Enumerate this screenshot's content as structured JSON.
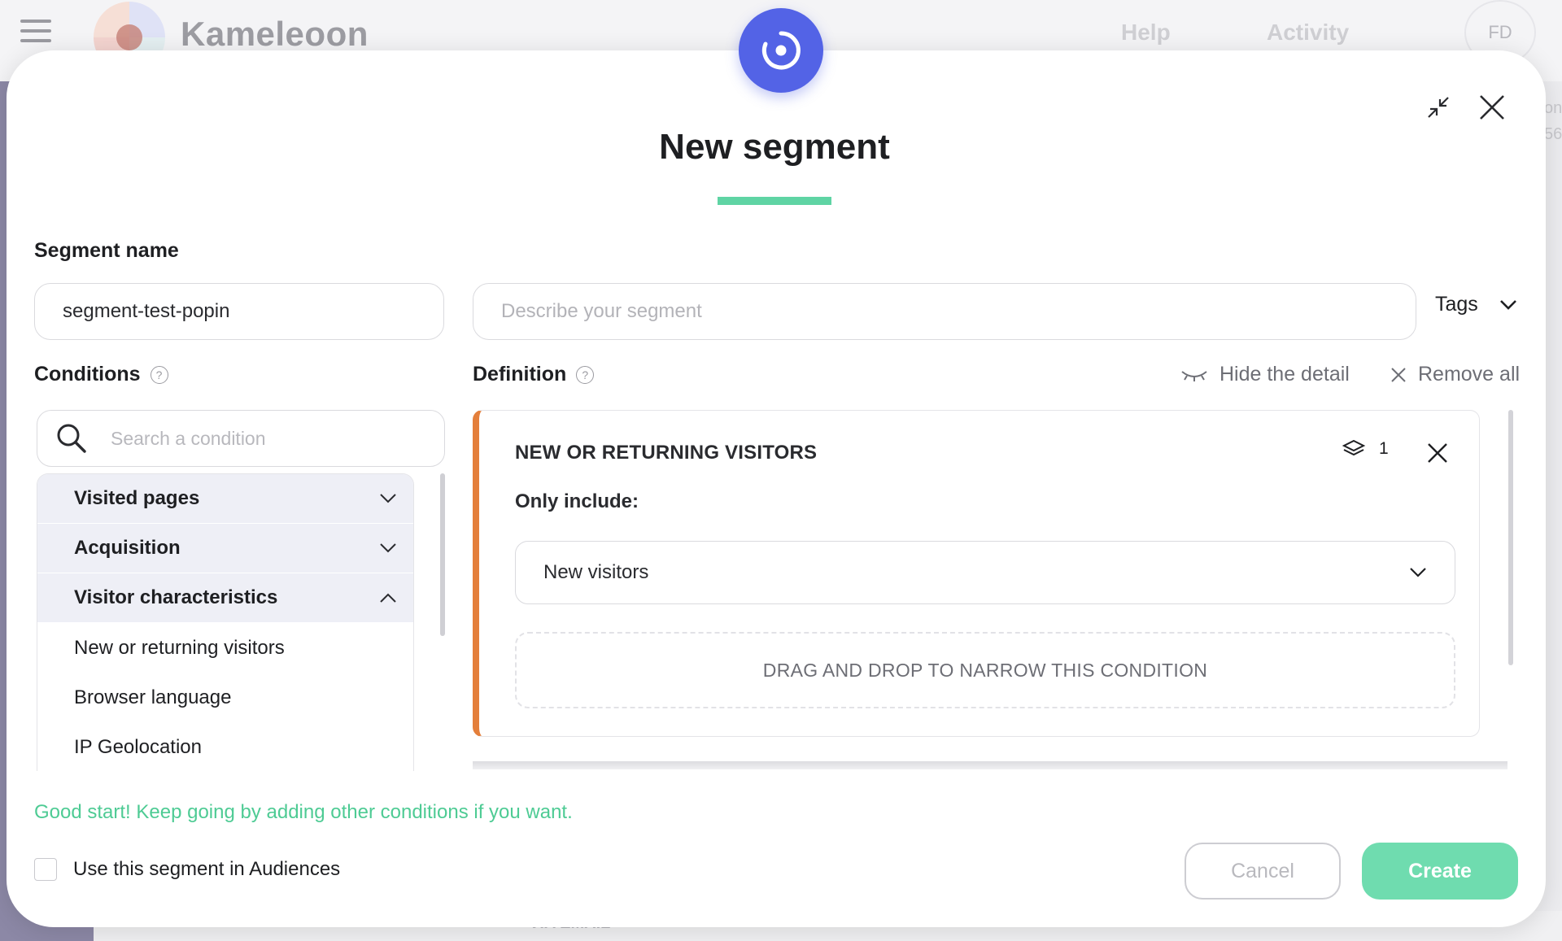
{
  "background": {
    "app_name": "Kameleoon",
    "nav": [
      "Help",
      "Activity"
    ],
    "avatar_initials": "FD",
    "bottom_text": "VIA EMAIL",
    "right_edge": [
      "on",
      "56"
    ]
  },
  "modal": {
    "title": "New segment",
    "segment_name_label": "Segment name",
    "segment_name_value": "segment-test-popin",
    "description_placeholder": "Describe your segment",
    "tags_label": "Tags",
    "accent_color": "#5fd4a4",
    "badge_color": "#5363e6"
  },
  "conditions": {
    "label": "Conditions",
    "search_placeholder": "Search a condition",
    "groups": [
      {
        "label": "Visited pages",
        "expanded": false
      },
      {
        "label": "Acquisition",
        "expanded": false
      },
      {
        "label": "Visitor characteristics",
        "expanded": true
      }
    ],
    "items": [
      "New or returning visitors",
      "Browser language",
      "IP Geolocation"
    ]
  },
  "definition": {
    "label": "Definition",
    "hide_detail": "Hide the detail",
    "remove_all": "Remove all",
    "card": {
      "title": "NEW OR RETURNING VISITORS",
      "count": "1",
      "subtitle": "Only include:",
      "selected_option": "New visitors",
      "dropzone_text": "DRAG AND DROP TO NARROW THIS CONDITION",
      "accent_color": "#e47f3b"
    }
  },
  "footer": {
    "hint": "Good start! Keep going by adding other conditions if you want.",
    "checkbox_label": "Use this segment in Audiences",
    "checkbox_checked": false,
    "cancel_label": "Cancel",
    "create_label": "Create"
  }
}
